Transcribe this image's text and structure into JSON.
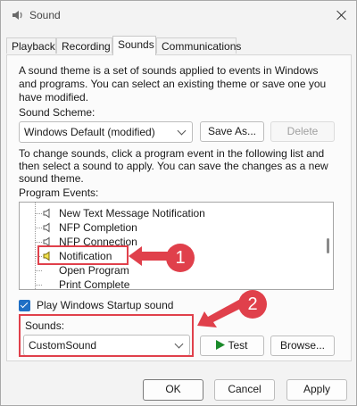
{
  "window": {
    "title": "Sound",
    "close_label": "Close"
  },
  "tabs": [
    {
      "label": "Playback",
      "active": false
    },
    {
      "label": "Recording",
      "active": false
    },
    {
      "label": "Sounds",
      "active": true
    },
    {
      "label": "Communications",
      "active": false
    }
  ],
  "description": {
    "line1": "A sound theme is a set of sounds applied to events in Windows",
    "line2": "and programs.  You can select an existing theme or save one you",
    "line3": "have modified."
  },
  "scheme": {
    "label": "Sound Scheme:",
    "value": "Windows Default (modified)",
    "save_as": "Save As...",
    "delete": "Delete"
  },
  "instructions": {
    "line1": "To change sounds, click a program event in the following list and",
    "line2": "then select a sound to apply.  You can save the changes as a new",
    "line3": "sound theme."
  },
  "program_events": {
    "label": "Program Events:",
    "items": [
      {
        "label": "New Text Message Notification",
        "has_icon": true,
        "selected": false
      },
      {
        "label": "NFP Completion",
        "has_icon": true,
        "selected": false
      },
      {
        "label": "NFP Connection",
        "has_icon": true,
        "selected": false
      },
      {
        "label": "Notification",
        "has_icon": true,
        "selected": true
      },
      {
        "label": "Open Program",
        "has_icon": false,
        "selected": false
      },
      {
        "label": "Print Complete",
        "has_icon": false,
        "selected": false
      }
    ]
  },
  "startup": {
    "label": "Play Windows Startup sound",
    "checked": true
  },
  "sounds": {
    "label": "Sounds:",
    "value": "CustomSound",
    "test": "Test",
    "browse": "Browse..."
  },
  "footer": {
    "ok": "OK",
    "cancel": "Cancel",
    "apply": "Apply"
  },
  "annotations": {
    "badge1": "1",
    "badge2": "2"
  },
  "colors": {
    "accent": "#1f6fc5",
    "annotation": "#e0404b",
    "test_arrow": "#1a8a2a"
  }
}
